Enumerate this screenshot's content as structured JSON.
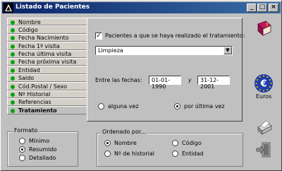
{
  "window": {
    "title": "Listado de Pacientes"
  },
  "tabs": [
    {
      "label": "Nombre"
    },
    {
      "label": "Código"
    },
    {
      "label": "Fecha Nacimiento"
    },
    {
      "label": "Fecha 1ª visita"
    },
    {
      "label": "Fecha última visita"
    },
    {
      "label": "Fecha próxima visita"
    },
    {
      "label": "Entidad"
    },
    {
      "label": "Saldo"
    },
    {
      "label": "Cód.Postal / Sexo"
    },
    {
      "label": "Nº Historial"
    },
    {
      "label": "Referencias"
    },
    {
      "label": "Tratamiento"
    }
  ],
  "active_tab": "Tratamiento",
  "treatment": {
    "checkbox_label": "Pacientes a que se haya realizado el tratamiento:",
    "checked": true,
    "selected_treatment": "Limpieza",
    "dates_label": "Entre las fechas:",
    "date_from": "01-01-1990",
    "date_conj": "y",
    "date_to": "31-12-2001",
    "option_any": "alguna vez",
    "option_last": "por última vez",
    "selected_option": "por última vez"
  },
  "format": {
    "label": "Formato",
    "options": [
      "Mínimo",
      "Resumido",
      "Detallado"
    ],
    "selected": "Resumido"
  },
  "order": {
    "label": "Ordenado por...",
    "options": [
      "Nombre",
      "Código",
      "Nº de historial",
      "Entidad"
    ],
    "selected": "Nombre"
  },
  "side": {
    "euros_label": "Euros"
  },
  "colors": {
    "title_bg": "#0a246a",
    "tab_dot": "#0aa30a",
    "euro_blue": "#1f3fa6"
  }
}
